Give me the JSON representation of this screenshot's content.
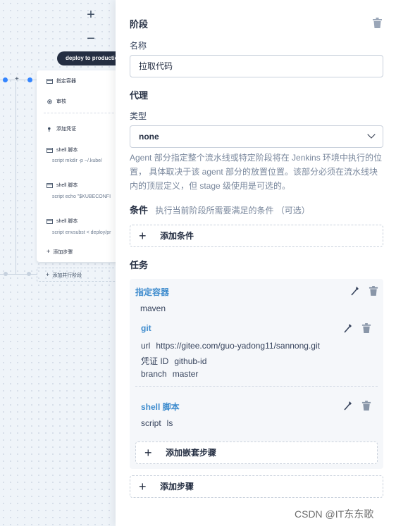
{
  "canvas": {
    "zoom_in_label": "+",
    "zoom_out_label": "−",
    "stage_tag": "deploy to production",
    "items": {
      "container": "指定容器",
      "review": "审核",
      "credential": "添加凭证",
      "shell1_title": "shell 脚本",
      "shell1_code": "script   mkdir -p ~/.kube/",
      "shell2_title": "shell 脚本",
      "shell2_code": "script   echo \"$KUBECONFI",
      "shell3_title": "shell 脚本",
      "shell3_code": "script   envsubst < deploy/pr",
      "add_step": "添加步骤",
      "add_parallel": "添加并行阶段"
    }
  },
  "panel": {
    "stage_heading": "阶段",
    "name_label": "名称",
    "name_value": "拉取代码",
    "agent_heading": "代理",
    "type_label": "类型",
    "type_value": "none",
    "agent_desc": "Agent 部分指定整个流水线或特定阶段将在 Jenkins 环境中执行的位置， 具体取决于该 agent 部分的放置位置。该部分必须在流水线块内的顶层定义，但 stage 级使用是可选的。",
    "conditions_heading": "条件",
    "conditions_hint": "执行当前阶段所需要满足的条件 （可选）",
    "add_condition": "添加条件",
    "tasks_heading": "任务",
    "task": {
      "container_title": "指定容器",
      "container_value": "maven",
      "git_title": "git",
      "git_url_key": "url",
      "git_url_value": "https://gitee.com/guo-yadong11/sannong.git",
      "git_cred_key": "凭证 ID",
      "git_cred_value": "github-id",
      "git_branch_key": "branch",
      "git_branch_value": "master",
      "shell_title": "shell 脚本",
      "shell_key": "script",
      "shell_value": "ls",
      "add_nested": "添加嵌套步骤"
    },
    "add_step": "添加步骤"
  },
  "watermark": "CSDN @IT东东歌",
  "colors": {
    "accent": "#3d8bcd",
    "dark": "#242e42",
    "text": "#36435c",
    "muted": "#79879c",
    "canvas_bg": "#eff4f9",
    "node_blue": "#3385ff"
  }
}
